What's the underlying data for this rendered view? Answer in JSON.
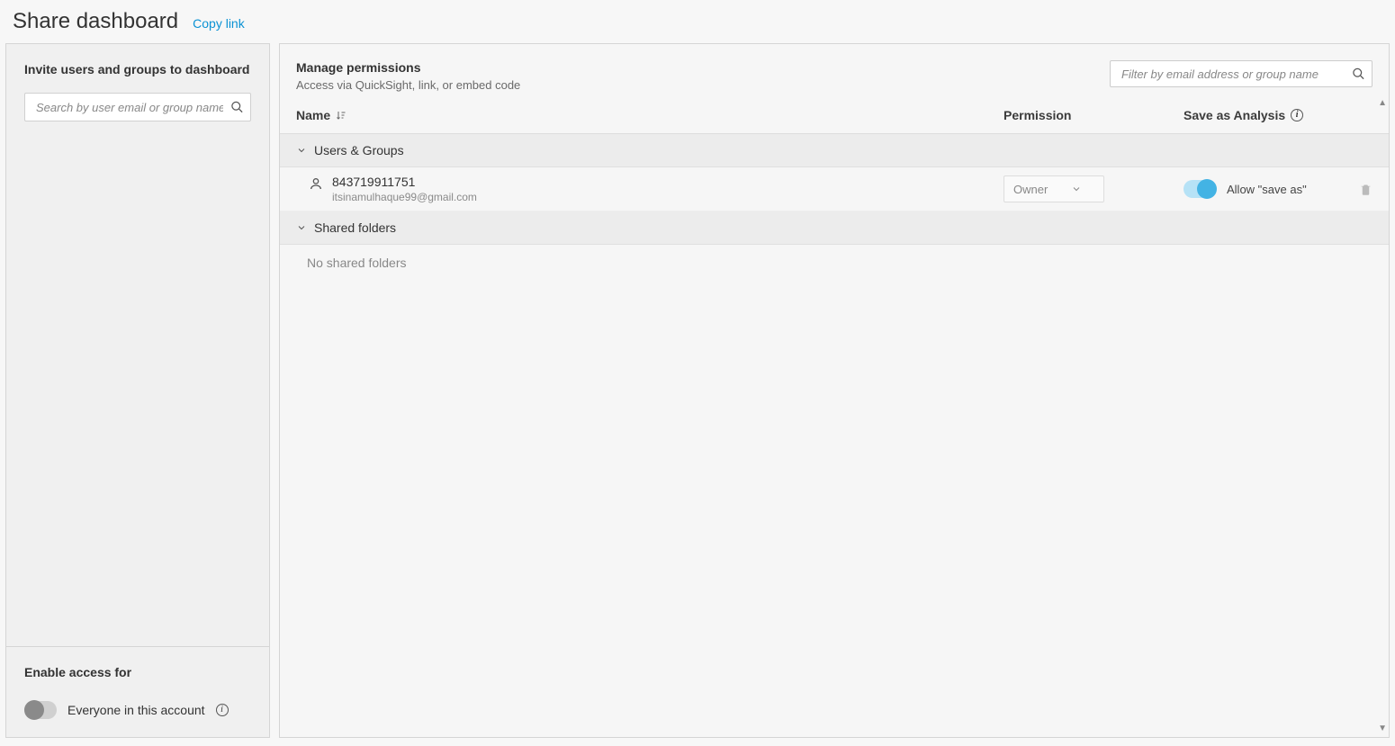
{
  "header": {
    "title": "Share dashboard",
    "copy_link": "Copy link"
  },
  "sidebar": {
    "invite_title": "Invite users and groups to dashboard",
    "search_placeholder": "Search by user email or group name",
    "enable_access_title": "Enable access for",
    "everyone_label": "Everyone in this account"
  },
  "main": {
    "manage_title": "Manage permissions",
    "manage_subtitle": "Access via QuickSight, link, or embed code",
    "filter_placeholder": "Filter by email address or group name",
    "columns": {
      "name": "Name",
      "permission": "Permission",
      "save_as": "Save as Analysis"
    },
    "groups": {
      "users_groups": "Users & Groups",
      "shared_folders": "Shared folders"
    },
    "rows": [
      {
        "id": "843719911751",
        "email": "itsinamulhaque99@gmail.com",
        "permission": "Owner",
        "save_as_label": "Allow \"save as\"",
        "save_as_on": true
      }
    ],
    "no_shared_folders": "No shared folders"
  }
}
